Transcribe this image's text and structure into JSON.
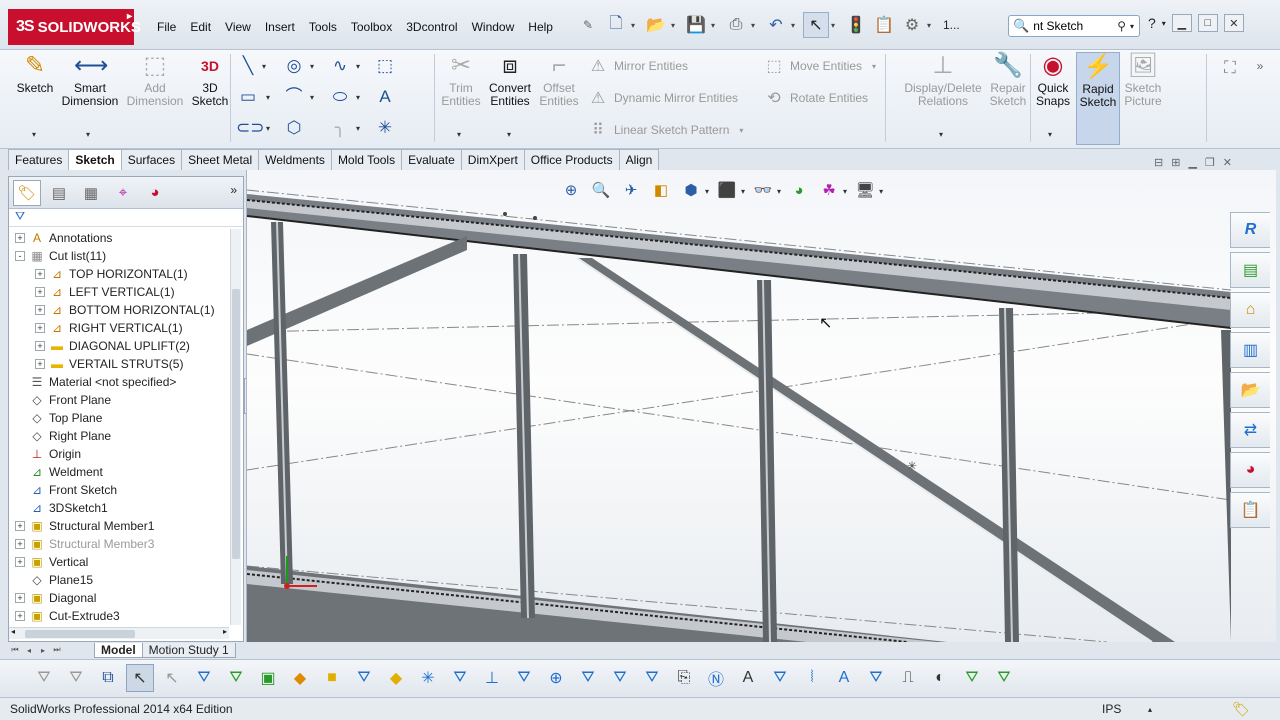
{
  "app": {
    "logo_text": "SOLIDWORKS",
    "logo_mark": "3S",
    "menus": [
      "File",
      "Edit",
      "View",
      "Insert",
      "Tools",
      "Toolbox",
      "3Dcontrol",
      "Window",
      "Help"
    ],
    "quick_items": [
      "new-icon",
      "open-icon",
      "save-icon",
      "print-icon",
      "undo-icon",
      "select-icon",
      "rebuild-icon",
      "options-icon"
    ],
    "quick_number": "1...",
    "search_value": "nt Sketch",
    "colors": {
      "brand": "#c8102e",
      "accent": "#2b5fa5"
    }
  },
  "commands": {
    "sketch": "Sketch",
    "smart_dimension": "Smart\nDimension",
    "add_dimension": "Add\nDimension",
    "sketch3d": "3D\nSketch",
    "trim": "Trim\nEntities",
    "convert": "Convert\nEntities",
    "offset": "Offset\nEntities",
    "mirror": "Mirror Entities",
    "dynamic_mirror": "Dynamic Mirror Entities",
    "linear_pattern": "Linear Sketch Pattern",
    "move": "Move Entities",
    "rotate": "Rotate Entities",
    "display_delete": "Display/Delete\nRelations",
    "repair": "Repair\nSketch",
    "quick_snaps": "Quick\nSnaps",
    "rapid_sketch": "Rapid\nSketch",
    "sketch_picture": "Sketch\nPicture"
  },
  "tabs": [
    "Features",
    "Sketch",
    "Surfaces",
    "Sheet Metal",
    "Weldments",
    "Mold Tools",
    "Evaluate",
    "DimXpert",
    "Office Products",
    "Align"
  ],
  "active_tab": "Sketch",
  "tree": [
    {
      "label": "Annotations",
      "icon": "annotations-icon",
      "exp": "+",
      "indent": 0
    },
    {
      "label": "Cut list(11)",
      "icon": "cutlist-icon",
      "exp": "-",
      "indent": 0
    },
    {
      "label": "TOP HORIZONTAL(1)",
      "icon": "weldment-member-icon",
      "exp": "+",
      "indent": 1
    },
    {
      "label": "LEFT VERTICAL(1)",
      "icon": "weldment-member-icon",
      "exp": "+",
      "indent": 1
    },
    {
      "label": "BOTTOM HORIZONTAL(1)",
      "icon": "weldment-member-icon",
      "exp": "+",
      "indent": 1
    },
    {
      "label": "RIGHT VERTICAL(1)",
      "icon": "weldment-member-icon",
      "exp": "+",
      "indent": 1
    },
    {
      "label": "DIAGONAL UPLIFT(2)",
      "icon": "folder-icon",
      "exp": "+",
      "indent": 1
    },
    {
      "label": "VERTAIL STRUTS(5)",
      "icon": "folder-icon",
      "exp": "+",
      "indent": 1
    },
    {
      "label": "Material <not specified>",
      "icon": "material-icon",
      "exp": "",
      "indent": 0
    },
    {
      "label": "Front Plane",
      "icon": "plane-icon",
      "exp": "",
      "indent": 0
    },
    {
      "label": "Top Plane",
      "icon": "plane-icon",
      "exp": "",
      "indent": 0
    },
    {
      "label": "Right Plane",
      "icon": "plane-icon",
      "exp": "",
      "indent": 0
    },
    {
      "label": "Origin",
      "icon": "origin-icon",
      "exp": "",
      "indent": 0
    },
    {
      "label": "Weldment",
      "icon": "weldment-icon",
      "exp": "",
      "indent": 0
    },
    {
      "label": "Front Sketch",
      "icon": "sketch-icon",
      "exp": "",
      "indent": 0
    },
    {
      "label": "3DSketch1",
      "icon": "sketch3d-icon",
      "exp": "",
      "indent": 0
    },
    {
      "label": "Structural Member1",
      "icon": "structural-member-icon",
      "exp": "+",
      "indent": 0
    },
    {
      "label": "Structural Member3",
      "icon": "structural-member-icon",
      "exp": "+",
      "indent": 0,
      "dim": true
    },
    {
      "label": "Vertical",
      "icon": "structural-member-icon",
      "exp": "+",
      "indent": 0
    },
    {
      "label": "Plane15",
      "icon": "plane-icon",
      "exp": "",
      "indent": 0
    },
    {
      "label": "Diagonal",
      "icon": "structural-member-icon",
      "exp": "+",
      "indent": 0
    },
    {
      "label": "Cut-Extrude3",
      "icon": "cut-extrude-icon",
      "exp": "+",
      "indent": 0
    }
  ],
  "model_tabs": [
    "Model",
    "Motion Study 1"
  ],
  "status": {
    "edition": "SolidWorks Professional 2014 x64 Edition",
    "units": "IPS"
  }
}
